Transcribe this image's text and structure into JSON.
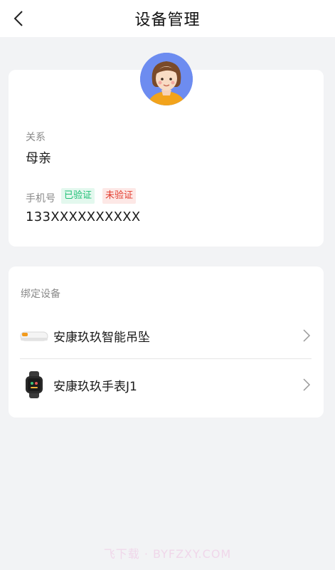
{
  "header": {
    "title": "设备管理",
    "back_icon": "chevron-left-icon"
  },
  "profile": {
    "avatar_icon": "female-avatar-icon",
    "relation_label": "关系",
    "relation_value": "母亲",
    "phone_label": "手机号",
    "tag_verified": "已验证",
    "tag_unverified": "未验证",
    "phone_value": "133XXXXXXXXXX"
  },
  "devices": {
    "section_label": "绑定设备",
    "items": [
      {
        "name": "安康玖玖智能吊坠",
        "icon": "pendant-device-icon"
      },
      {
        "name": "安康玖玖手表J1",
        "icon": "smartwatch-icon"
      }
    ]
  },
  "watermark": "飞下载 · BYFZXY.COM",
  "colors": {
    "background": "#f2f3f5",
    "verified_text": "#1fbf75",
    "verified_bg": "#e3f8ee",
    "unverified_text": "#e23c2e",
    "unverified_bg": "#fde8e6",
    "avatar_bg": "#6d8cf0"
  }
}
